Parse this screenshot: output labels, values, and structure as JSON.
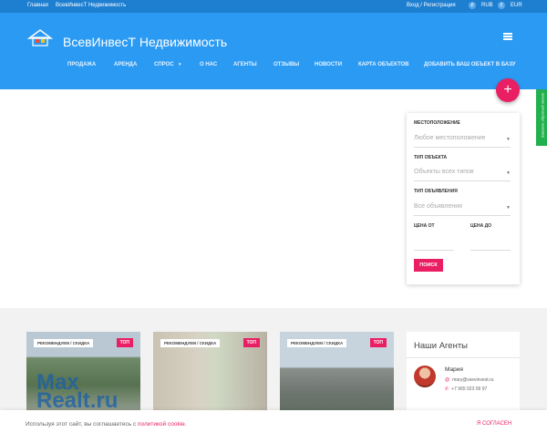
{
  "topbar": {
    "home": "Главная",
    "breadcrumb": "ВсевИнвесТ Недвижимость",
    "login": "Вход / Регистрация",
    "cur1": "RUB",
    "cur2": "EUR"
  },
  "header": {
    "title": "ВсевИнвесТ Недвижимость"
  },
  "nav": [
    "ПРОДАЖА",
    "АРЕНДА",
    "СПРОС",
    "О НАС",
    "АГЕНТЫ",
    "ОТЗЫВЫ",
    "НОВОСТИ",
    "КАРТА ОБЪЕКТОВ",
    "ДОБАВИТЬ ВАШ ОБЪЕКТ В БАЗУ"
  ],
  "callback": "Заказать обратный звонок",
  "search": {
    "location_label": "МЕСТОПОЛОЖЕНИЕ",
    "location_value": "Любое местоположение",
    "type_label": "ТИП ОБЪЕКТА",
    "type_value": "Объекты всех типов",
    "ad_label": "ТИП ОБЪЯВЛЕНИЯ",
    "ad_value": "Все объявления",
    "price_from": "ЦЕНА ОТ",
    "price_to": "ЦЕНА ДО",
    "button": "ПОИСК"
  },
  "cards": [
    {
      "badge": "РЕКОМЕНДУЕМ / СКИДКА",
      "top": "ТОП"
    },
    {
      "badge": "РЕКОМЕНДУЕМ / СКИДКА",
      "top": "ТОП"
    },
    {
      "badge": "РЕКОМЕНДУЕМ / СКИДКА",
      "top": "ТОП"
    }
  ],
  "agents": {
    "title": "Наши Агенты",
    "name": "Мария",
    "email": "mary@vsevinvest.ru",
    "phone": "+7 965 023 09 97"
  },
  "watermark": {
    "line1": "Max",
    "line2": "Realt.ru"
  },
  "cookie": {
    "text": "Используя этот сайт, вы соглашаетесь с",
    "link": "политикой cookie",
    "agree": "Я СОГЛАСЕН"
  }
}
